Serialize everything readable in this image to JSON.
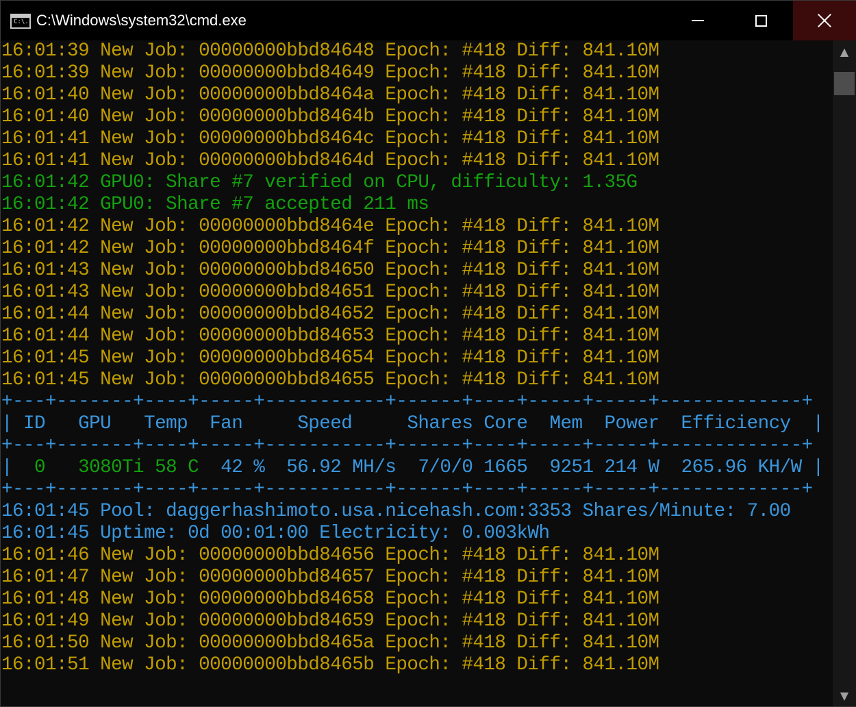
{
  "window": {
    "title": "C:\\Windows\\system32\\cmd.exe",
    "icon_label": "C:\\.",
    "controls": {
      "minimize": "minimize-icon",
      "maximize": "maximize-icon",
      "close": "close-icon"
    }
  },
  "colors": {
    "background": "#0c0c0c",
    "yellow": "#c19c00",
    "green": "#13a10e",
    "blue": "#3a96dd"
  },
  "console": {
    "lines": [
      {
        "text": "16:01:39 New Job: 00000000bbd84648 Epoch: #418 Diff: 841.10M",
        "color": "yellow"
      },
      {
        "text": "16:01:39 New Job: 00000000bbd84649 Epoch: #418 Diff: 841.10M",
        "color": "yellow"
      },
      {
        "text": "16:01:40 New Job: 00000000bbd8464a Epoch: #418 Diff: 841.10M",
        "color": "yellow"
      },
      {
        "text": "16:01:40 New Job: 00000000bbd8464b Epoch: #418 Diff: 841.10M",
        "color": "yellow"
      },
      {
        "text": "16:01:41 New Job: 00000000bbd8464c Epoch: #418 Diff: 841.10M",
        "color": "yellow"
      },
      {
        "text": "16:01:41 New Job: 00000000bbd8464d Epoch: #418 Diff: 841.10M",
        "color": "yellow"
      },
      {
        "text": "16:01:42 GPU0: Share #7 verified on CPU, difficulty: 1.35G",
        "color": "green"
      },
      {
        "text": "16:01:42 GPU0: Share #7 accepted 211 ms",
        "color": "green"
      },
      {
        "text": "16:01:42 New Job: 00000000bbd8464e Epoch: #418 Diff: 841.10M",
        "color": "yellow"
      },
      {
        "text": "16:01:42 New Job: 00000000bbd8464f Epoch: #418 Diff: 841.10M",
        "color": "yellow"
      },
      {
        "text": "16:01:43 New Job: 00000000bbd84650 Epoch: #418 Diff: 841.10M",
        "color": "yellow"
      },
      {
        "text": "16:01:43 New Job: 00000000bbd84651 Epoch: #418 Diff: 841.10M",
        "color": "yellow"
      },
      {
        "text": "16:01:44 New Job: 00000000bbd84652 Epoch: #418 Diff: 841.10M",
        "color": "yellow"
      },
      {
        "text": "16:01:44 New Job: 00000000bbd84653 Epoch: #418 Diff: 841.10M",
        "color": "yellow"
      },
      {
        "text": "16:01:45 New Job: 00000000bbd84654 Epoch: #418 Diff: 841.10M",
        "color": "yellow"
      },
      {
        "text": "16:01:45 New Job: 00000000bbd84655 Epoch: #418 Diff: 841.10M",
        "color": "yellow"
      },
      {
        "text": "+---+-------+----+-----+-----------+------+----+-----+-----+-------------+",
        "color": "blue"
      },
      {
        "text": "| ID   GPU   Temp  Fan     Speed     Shares Core  Mem  Power  Efficiency  |",
        "color": "blue"
      },
      {
        "text": "+---+-------+----+-----+-----------+------+----+-----+-----+-------------+",
        "color": "blue"
      },
      {
        "segments": [
          {
            "text": "|  ",
            "color": "blue"
          },
          {
            "text": "0   3080Ti 58 C",
            "color": "green"
          },
          {
            "text": "  42 %  56.92 MH/s  7/0/0 1665  9251 214 W  265.96 KH/W |",
            "color": "blue"
          }
        ]
      },
      {
        "text": "+---+-------+----+-----+-----------+------+----+-----+-----+-------------+",
        "color": "blue"
      },
      {
        "text": "16:01:45 Pool: daggerhashimoto.usa.nicehash.com:3353 Shares/Minute: 7.00",
        "color": "blue"
      },
      {
        "text": "16:01:45 Uptime: 0d 00:01:00 Electricity: 0.003kWh",
        "color": "blue"
      },
      {
        "text": "16:01:46 New Job: 00000000bbd84656 Epoch: #418 Diff: 841.10M",
        "color": "yellow"
      },
      {
        "text": "16:01:47 New Job: 00000000bbd84657 Epoch: #418 Diff: 841.10M",
        "color": "yellow"
      },
      {
        "text": "16:01:48 New Job: 00000000bbd84658 Epoch: #418 Diff: 841.10M",
        "color": "yellow"
      },
      {
        "text": "16:01:49 New Job: 00000000bbd84659 Epoch: #418 Diff: 841.10M",
        "color": "yellow"
      },
      {
        "text": "16:01:50 New Job: 00000000bbd8465a Epoch: #418 Diff: 841.10M",
        "color": "yellow"
      },
      {
        "text": "16:01:51 New Job: 00000000bbd8465b Epoch: #418 Diff: 841.10M",
        "color": "yellow"
      }
    ]
  },
  "scrollbar": {
    "up_icon": "▲",
    "down_icon": "▼"
  }
}
